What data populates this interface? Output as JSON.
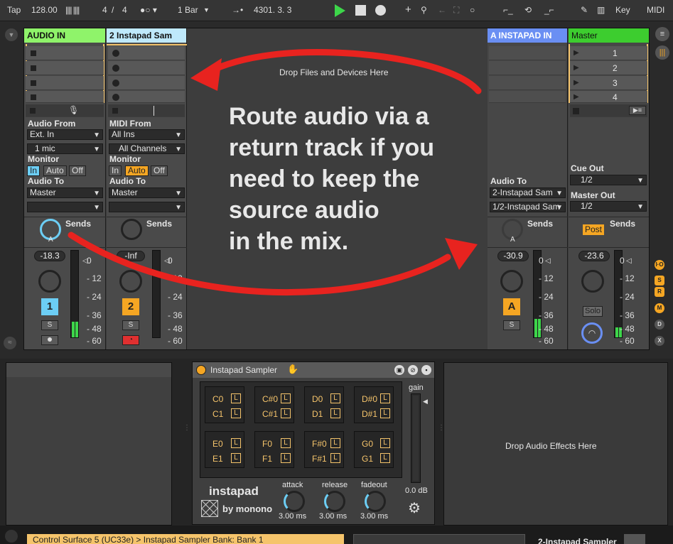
{
  "transport": {
    "tap": "Tap",
    "tempo": "128.00",
    "meter_num": "4",
    "meter_slash": "/",
    "meter_den": "4",
    "quantize": "1 Bar",
    "arrangement_pos": "4301.  3.  3",
    "key": "Key",
    "midi": "MIDI"
  },
  "session": {
    "drop_text": "Drop Files and Devices Here",
    "tracks": [
      {
        "name": "AUDIO IN",
        "color": "#8ff36a",
        "in_label": "Audio From",
        "in_value": "Ext. In",
        "chan_value": "1 mic",
        "monitor_label": "Monitor",
        "mon_in": "In",
        "mon_auto": "Auto",
        "mon_off": "Off",
        "out_label": "Audio To",
        "out_value": "Master",
        "sends": "Sends",
        "send_letter": "A",
        "volume": "-18.3",
        "number": "1",
        "s": "S"
      },
      {
        "name": "2 Instapad Sam",
        "color": "#bfe9fb",
        "in_label": "MIDI From",
        "in_value": "All Ins",
        "chan_value": "All Channels",
        "monitor_label": "Monitor",
        "mon_in": "In",
        "mon_auto": "Auto",
        "mon_off": "Off",
        "out_label": "Audio To",
        "out_value": "Master",
        "sends": "Sends",
        "volume": "-Inf",
        "number": "2",
        "s": "S"
      },
      {
        "name": "A INSTAPAD IN",
        "color": "#6a8ff3",
        "out_label": "Audio To",
        "out_value": "2-Instapad Sam",
        "out_chan": "1/2-Instapad Sam",
        "sends": "Sends",
        "send_letter": "A",
        "volume": "-30.9",
        "number": "A",
        "s": "S"
      },
      {
        "name": "Master",
        "color": "#3dcd2f",
        "scenes": [
          "1",
          "2",
          "3",
          "4"
        ],
        "cue_label": "Cue Out",
        "cue_value": "1/2",
        "master_label": "Master Out",
        "master_value": "1/2",
        "post": "Post",
        "sends": "Sends",
        "volume": "-23.6",
        "solo": "Solo"
      }
    ],
    "meter_scale": [
      "0",
      "12",
      "24",
      "36",
      "48",
      "60"
    ],
    "side_buttons": [
      "I·O",
      "S",
      "R",
      "M",
      "D",
      "X"
    ]
  },
  "annotation": {
    "text": "Route audio via a return track if you need to keep the source audio in the mix.",
    "lines": [
      "Route audio via a",
      "return track if you",
      "need to keep the",
      "source audio",
      "in the mix."
    ],
    "arrow_color": "#e8231f"
  },
  "device": {
    "title": "Instapad Sampler",
    "pads": [
      [
        "C0",
        "C1"
      ],
      [
        "C#0",
        "C#1"
      ],
      [
        "D0",
        "D1"
      ],
      [
        "D#0",
        "D#1"
      ],
      [
        "E0",
        "E1"
      ],
      [
        "F0",
        "F1"
      ],
      [
        "F#0",
        "F#1"
      ],
      [
        "G0",
        "G1"
      ]
    ],
    "pad_l": "L",
    "gain_label": "gain",
    "gain_value": "0.0 dB",
    "brand": "instapad",
    "by": "by monono",
    "knobs": [
      {
        "label": "attack",
        "value": "3.00 ms"
      },
      {
        "label": "release",
        "value": "3.00 ms"
      },
      {
        "label": "fadeout",
        "value": "3.00 ms"
      }
    ],
    "drop_effects": "Drop Audio Effects Here"
  },
  "status": {
    "left": "Control Surface 5 (UC33e) > Instapad Sampler Bank: Bank 1",
    "right": "2-Instapad Sampler"
  }
}
